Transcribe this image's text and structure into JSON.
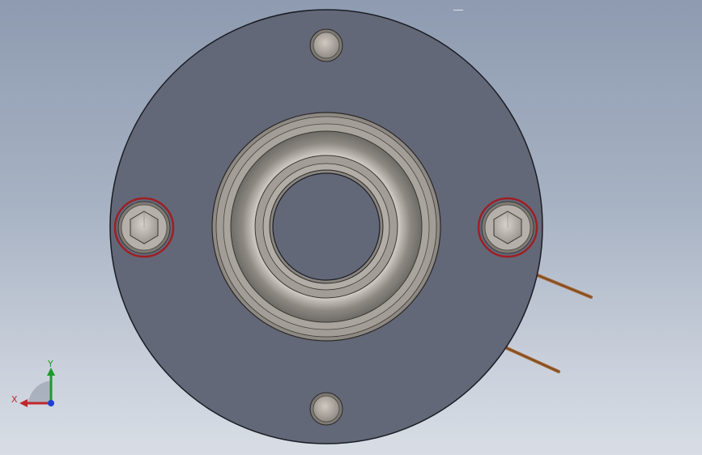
{
  "viewport": {
    "background_top": "#8e9bb0",
    "background_bottom": "#d8dde5"
  },
  "model": {
    "flange_color": "#636878",
    "bearing_color": "#aaa49b",
    "seal_ring_color": "#9e1f24",
    "wire_color": "#a2612c"
  },
  "triad": {
    "x_label": "X",
    "y_label": "Y",
    "x_color": "#c0262c",
    "y_color": "#1f9a2a",
    "z_color": "#1f3fcf"
  }
}
